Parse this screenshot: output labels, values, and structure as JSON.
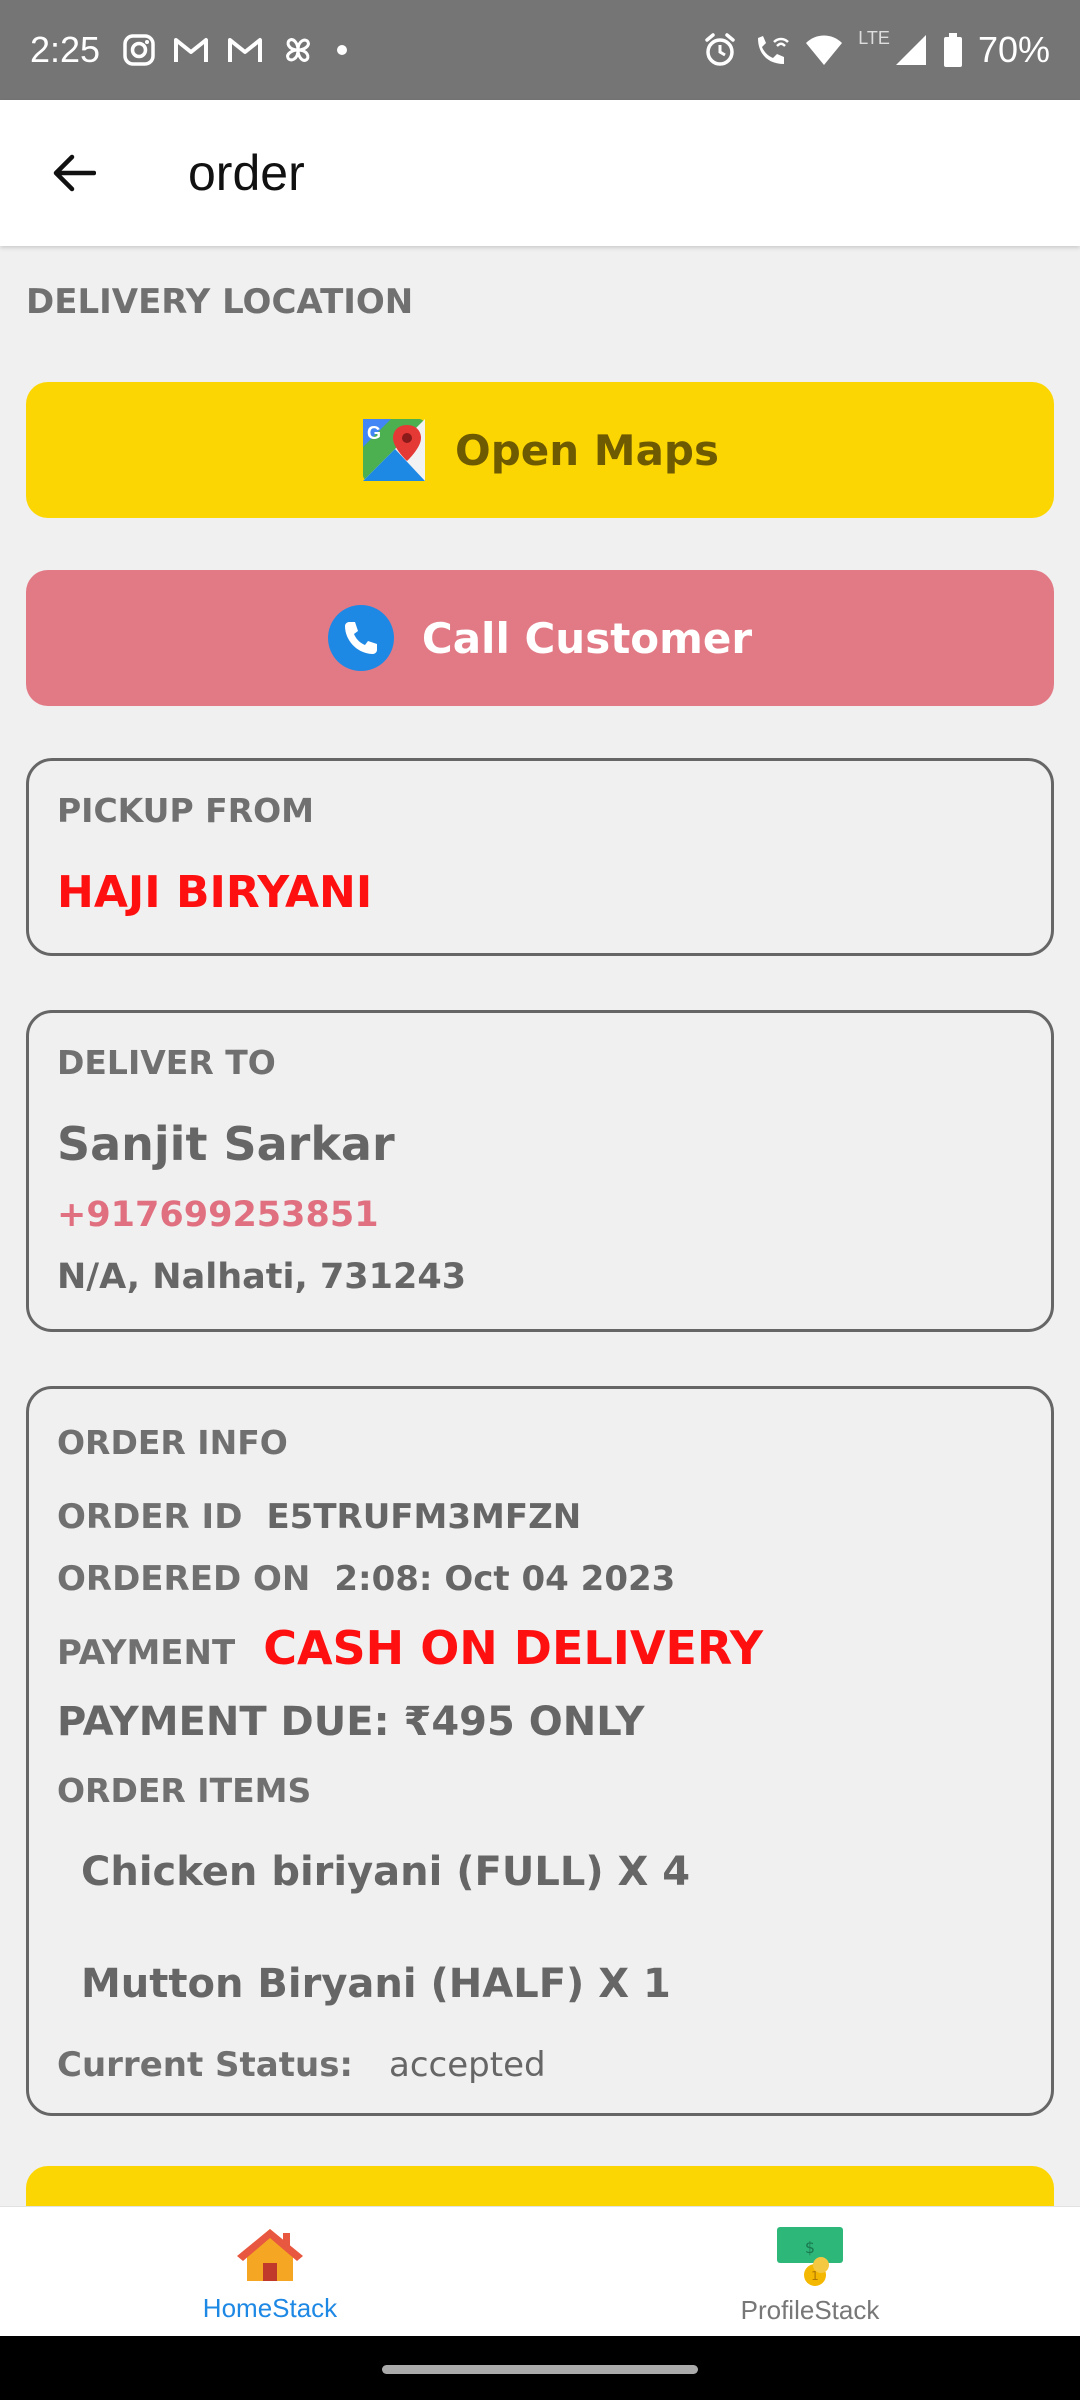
{
  "status_bar": {
    "time": "2:25",
    "battery": "70%",
    "network": "LTE",
    "notification_icons": [
      "instagram-icon",
      "gmail-icon",
      "gmail-icon",
      "pinwheel-icon",
      "dot-icon"
    ],
    "system_icons": [
      "alarm-icon",
      "wifi-call-icon",
      "wifi-icon",
      "signal-icon",
      "battery-icon"
    ]
  },
  "app_bar": {
    "title": "order",
    "back_icon": "arrow-left-icon"
  },
  "delivery_location": {
    "label": "DELIVERY LOCATION",
    "open_maps": "Open Maps",
    "call_customer": "Call Customer",
    "colors": {
      "maps_button": "#fcd602",
      "call_button": "#e27a86"
    }
  },
  "pickup": {
    "label": "PICKUP FROM",
    "restaurant": "HAJI BIRYANI"
  },
  "deliver_to": {
    "label": "DELIVER TO",
    "name": "Sanjit Sarkar",
    "phone": "+917699253851",
    "address": "N/A, Nalhati, 731243"
  },
  "order_info": {
    "label": "ORDER INFO",
    "order_id_label": "ORDER ID",
    "order_id": "E5TRUFM3MFZN",
    "ordered_on_label": "ORDERED ON",
    "ordered_on": "2:08: Oct 04 2023",
    "payment_label": "PAYMENT",
    "payment": "CASH ON DELIVERY",
    "payment_due": "PAYMENT DUE: ₹495 ONLY",
    "items_label": "ORDER ITEMS",
    "items": [
      "Chicken biriyani (FULL) X 4",
      "Mutton Biryani (HALF) X 1"
    ],
    "status_label": "Current Status:",
    "status": "accepted"
  },
  "bottom_nav": {
    "tabs": [
      {
        "label": "HomeStack",
        "icon": "home-icon",
        "active": true
      },
      {
        "label": "ProfileStack",
        "icon": "money-icon",
        "active": false
      }
    ],
    "active_color": "#1e88e5"
  }
}
